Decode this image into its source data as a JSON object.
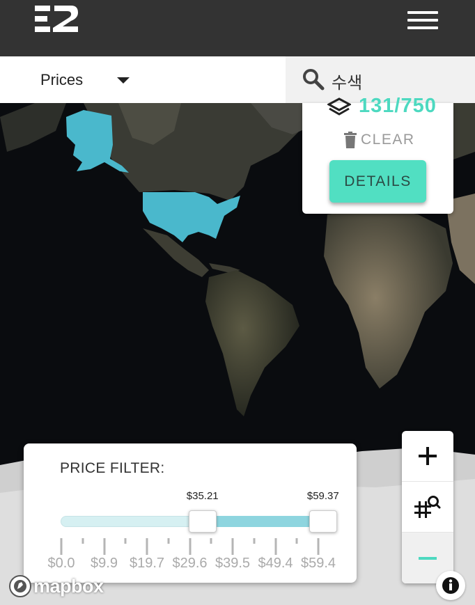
{
  "header": {
    "logo_text": "E2",
    "menu_icon": "hamburger-menu-icon"
  },
  "toolbar": {
    "prices_label": "Prices",
    "search_placeholder": "수색",
    "search_icon": "search-icon"
  },
  "layers_panel": {
    "count": "131/750",
    "clear_label": "CLEAR",
    "details_label": "DETAILS",
    "accent_color": "#4dd9c0"
  },
  "price_filter": {
    "title": "PRICE FILTER:",
    "range_min": 0.0,
    "range_max": 59.4,
    "low_value_label": "$35.21",
    "high_value_label": "$59.37",
    "low_value": 35.21,
    "high_value": 59.37,
    "tick_labels": [
      "$0.0",
      "$9.9",
      "$19.7",
      "$29.6",
      "$39.5",
      "$49.4",
      "$59.4"
    ]
  },
  "map_controls": {
    "zoom_in_icon": "plus-icon",
    "search_grid_icon": "grid-search-icon",
    "zoom_out_icon": "minus-icon"
  },
  "attribution": {
    "mapbox_label": "mapbox",
    "info_icon": "info-icon"
  },
  "colors": {
    "highlight_country": "#4ab8cc",
    "header_bg": "#333333"
  }
}
